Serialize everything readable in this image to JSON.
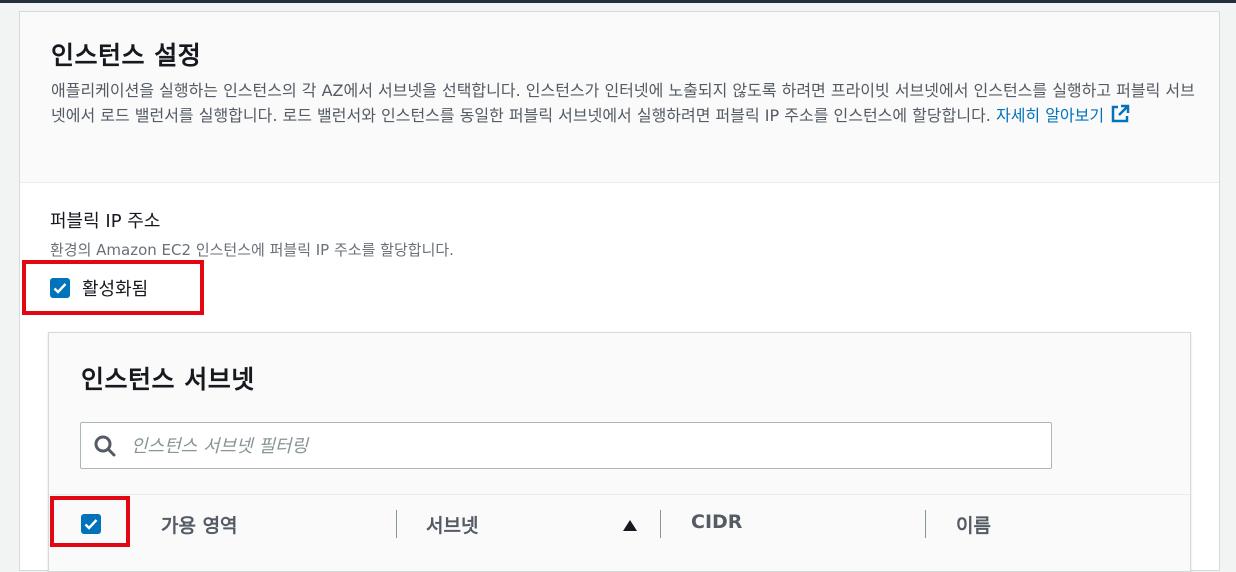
{
  "section": {
    "title": "인스턴스 설정",
    "description": "애플리케이션을 실행하는 인스턴스의 각 AZ에서 서브넷을 선택합니다. 인스턴스가 인터넷에 노출되지 않도록 하려면 프라이빗 서브넷에서 인스턴스를 실행하고 퍼블릭 서브넷에서 로드 밸런서를 실행합니다. 로드 밸런서와 인스턴스를 동일한 퍼블릭 서브넷에서 실행하려면 퍼블릭 IP 주소를 인스턴스에 할당합니다.",
    "learn_more": "자세히 알아보기"
  },
  "public_ip": {
    "label": "퍼블릭 IP 주소",
    "description": "환경의 Amazon EC2 인스턴스에 퍼블릭 IP 주소를 할당합니다.",
    "checkbox_label": "활성화됨",
    "checked": true
  },
  "subnets": {
    "title": "인스턴스 서브넷",
    "filter_placeholder": "인스턴스 서브넷 필터링",
    "filter_value": "",
    "columns": [
      "가용 영역",
      "서브넷",
      "CIDR",
      "이름"
    ],
    "sorted_column": "서브넷",
    "sort_direction": "ascending",
    "select_all_checked": true
  },
  "colors": {
    "accent": "#0073bb",
    "highlight": "#e30613"
  },
  "icons": {
    "external_link": "external-link-icon",
    "search": "search-icon",
    "checkbox": "checkmark-icon",
    "sort": "sort-ascending-icon"
  }
}
